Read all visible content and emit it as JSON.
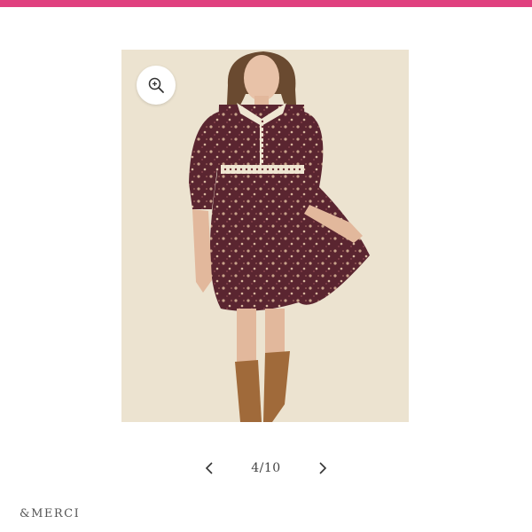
{
  "theme": {
    "accent": "#e0407f",
    "photo_background": "#ece3d0",
    "dress_color": "#5a2530",
    "boot_color": "#a06a3a"
  },
  "product_gallery": {
    "zoom_icon": "magnifier-plus-icon",
    "prev_icon": "chevron-left-icon",
    "next_icon": "chevron-right-icon",
    "counter": "4/10"
  },
  "footer": {
    "brand": "&MERCI"
  }
}
